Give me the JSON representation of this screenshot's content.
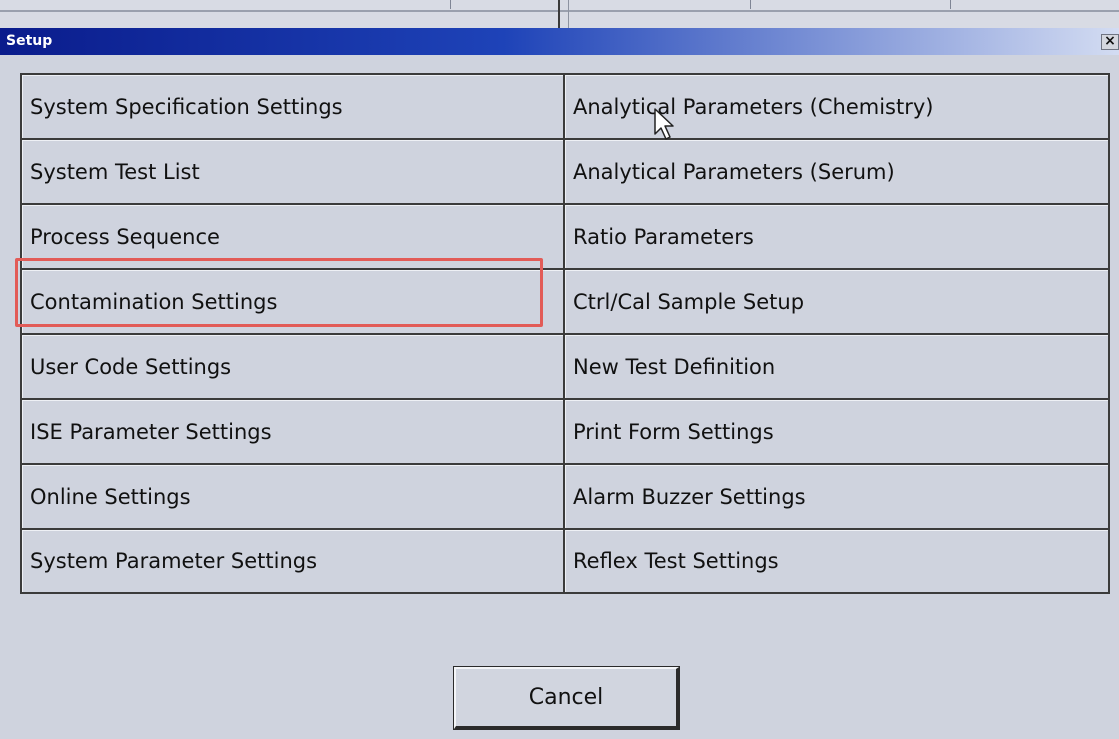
{
  "window": {
    "title": "Setup",
    "close_glyph": "×"
  },
  "menu": {
    "left": [
      "System Specification Settings",
      "System Test List",
      "Process Sequence",
      "Contamination Settings",
      "User Code Settings",
      "ISE Parameter Settings",
      "Online Settings",
      "System Parameter Settings"
    ],
    "right": [
      "Analytical Parameters (Chemistry)",
      "Analytical Parameters (Serum)",
      "Ratio Parameters",
      "Ctrl/Cal Sample Setup",
      "New Test Definition",
      "Print Form Settings",
      "Alarm Buzzer Settings",
      "Reflex Test Settings"
    ],
    "highlighted": "Contamination Settings"
  },
  "footer": {
    "cancel_label": "Cancel"
  },
  "colors": {
    "title_gradient_start": "#0a1c8c",
    "highlight_box": "#e25b57",
    "dialog_bg": "#cfd3de"
  },
  "icons": {
    "cursor": "arrow-cursor",
    "close": "close-icon"
  }
}
